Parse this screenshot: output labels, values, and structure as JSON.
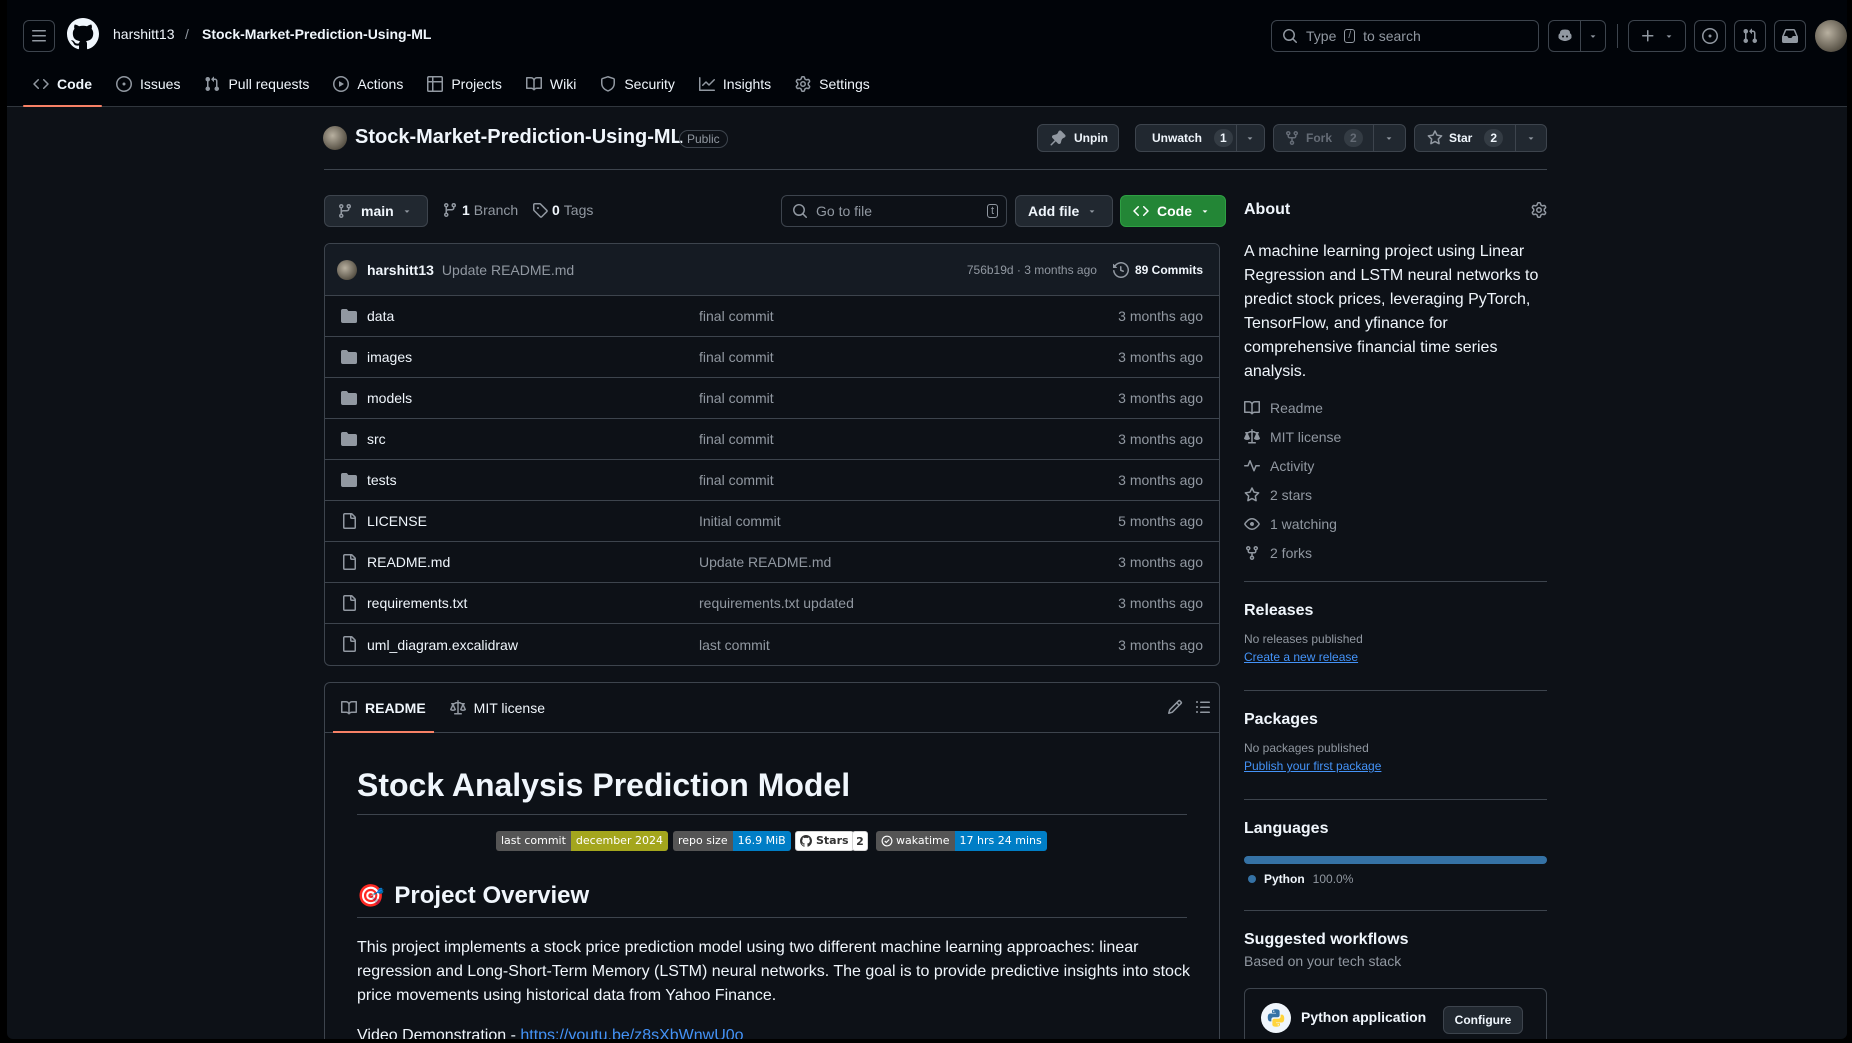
{
  "header": {
    "owner": "harshitt13",
    "slash": "/",
    "repo": "Stock-Market-Prediction-Using-ML",
    "search_pre": "Type",
    "search_key": "/",
    "search_post": "to search"
  },
  "nav": {
    "tabs": [
      {
        "label": "Code",
        "icon": "code-icon"
      },
      {
        "label": "Issues",
        "icon": "issue-icon"
      },
      {
        "label": "Pull requests",
        "icon": "pull-request-icon"
      },
      {
        "label": "Actions",
        "icon": "play-icon"
      },
      {
        "label": "Projects",
        "icon": "table-icon"
      },
      {
        "label": "Wiki",
        "icon": "book-icon"
      },
      {
        "label": "Security",
        "icon": "shield-icon"
      },
      {
        "label": "Insights",
        "icon": "graph-icon"
      },
      {
        "label": "Settings",
        "icon": "gear-icon"
      }
    ]
  },
  "repo": {
    "title": "Stock-Market-Prediction-Using-ML",
    "visibility": "Public",
    "unpin": "Unpin",
    "unwatch": "Unwatch",
    "watch_count": "1",
    "fork": "Fork",
    "fork_count": "2",
    "star": "Star",
    "star_count": "2"
  },
  "filenav": {
    "branch": "main",
    "branches_count": "1",
    "branches_label": "Branch",
    "tags_count": "0",
    "tags_label": "Tags",
    "goto_placeholder": "Go to file",
    "goto_key": "t",
    "add_file": "Add file",
    "code": "Code"
  },
  "commit": {
    "author": "harshitt13",
    "message": "Update README.md",
    "hash_time": "756b19d · 3 months ago",
    "commits": "89 Commits"
  },
  "files": [
    {
      "name": "data",
      "type": "folder",
      "message": "final commit",
      "age": "3 months ago"
    },
    {
      "name": "images",
      "type": "folder",
      "message": "final commit",
      "age": "3 months ago"
    },
    {
      "name": "models",
      "type": "folder",
      "message": "final commit",
      "age": "3 months ago"
    },
    {
      "name": "src",
      "type": "folder",
      "message": "final commit",
      "age": "3 months ago"
    },
    {
      "name": "tests",
      "type": "folder",
      "message": "final commit",
      "age": "3 months ago"
    },
    {
      "name": "LICENSE",
      "type": "file",
      "message": "Initial commit",
      "age": "5 months ago"
    },
    {
      "name": "README.md",
      "type": "file",
      "message": "Update README.md",
      "age": "3 months ago"
    },
    {
      "name": "requirements.txt",
      "type": "file",
      "message": "requirements.txt updated",
      "age": "3 months ago"
    },
    {
      "name": "uml_diagram.excalidraw",
      "type": "file",
      "message": "last commit",
      "age": "3 months ago"
    }
  ],
  "readme": {
    "tab_readme": "README",
    "tab_license": "MIT license",
    "h1": "Stock Analysis Prediction Model",
    "badges": {
      "last_commit_l": "last commit",
      "last_commit_r": "december 2024",
      "repo_size_l": "repo size",
      "repo_size_r": "16.9 MiB",
      "stars_l": "Stars",
      "stars_r": "2",
      "wakatime_l": "wakatime",
      "wakatime_r": "17 hrs 24 mins"
    },
    "h2_emoji": "🎯",
    "h2": "Project Overview",
    "paragraph": "This project implements a stock price prediction model using two different machine learning approaches: linear regression and Long-Short-Term Memory (LSTM) neural networks. The goal is to provide predictive insights into stock price movements using historical data from Yahoo Finance.",
    "video_label": "Video Demonstration - ",
    "video_link": "https://youtu.be/z8sXbWnwU0o"
  },
  "about": {
    "title": "About",
    "description": "A machine learning project using Linear Regression and LSTM neural networks to predict stock prices, leveraging PyTorch, TensorFlow, and yfinance for comprehensive financial time series analysis.",
    "links": [
      {
        "label": "Readme",
        "icon": "book-icon"
      },
      {
        "label": "MIT license",
        "icon": "law-icon"
      },
      {
        "label": "Activity",
        "icon": "pulse-icon"
      },
      {
        "label": "2 stars",
        "icon": "star-icon"
      },
      {
        "label": "1 watching",
        "icon": "eye-icon"
      },
      {
        "label": "2 forks",
        "icon": "fork-icon"
      }
    ]
  },
  "releases": {
    "title": "Releases",
    "empty": "No releases published",
    "link": "Create a new release"
  },
  "packages": {
    "title": "Packages",
    "empty": "No packages published",
    "link": "Publish your first package"
  },
  "languages": {
    "title": "Languages",
    "name": "Python",
    "percent": "100.0%",
    "color": "#3572A5"
  },
  "workflows": {
    "title": "Suggested workflows",
    "subtitle": "Based on your tech stack",
    "item": "Python application",
    "configure": "Configure"
  },
  "colors": {
    "accent_tab": "#f78166",
    "code_button": "#238636",
    "link": "#4493f8"
  }
}
